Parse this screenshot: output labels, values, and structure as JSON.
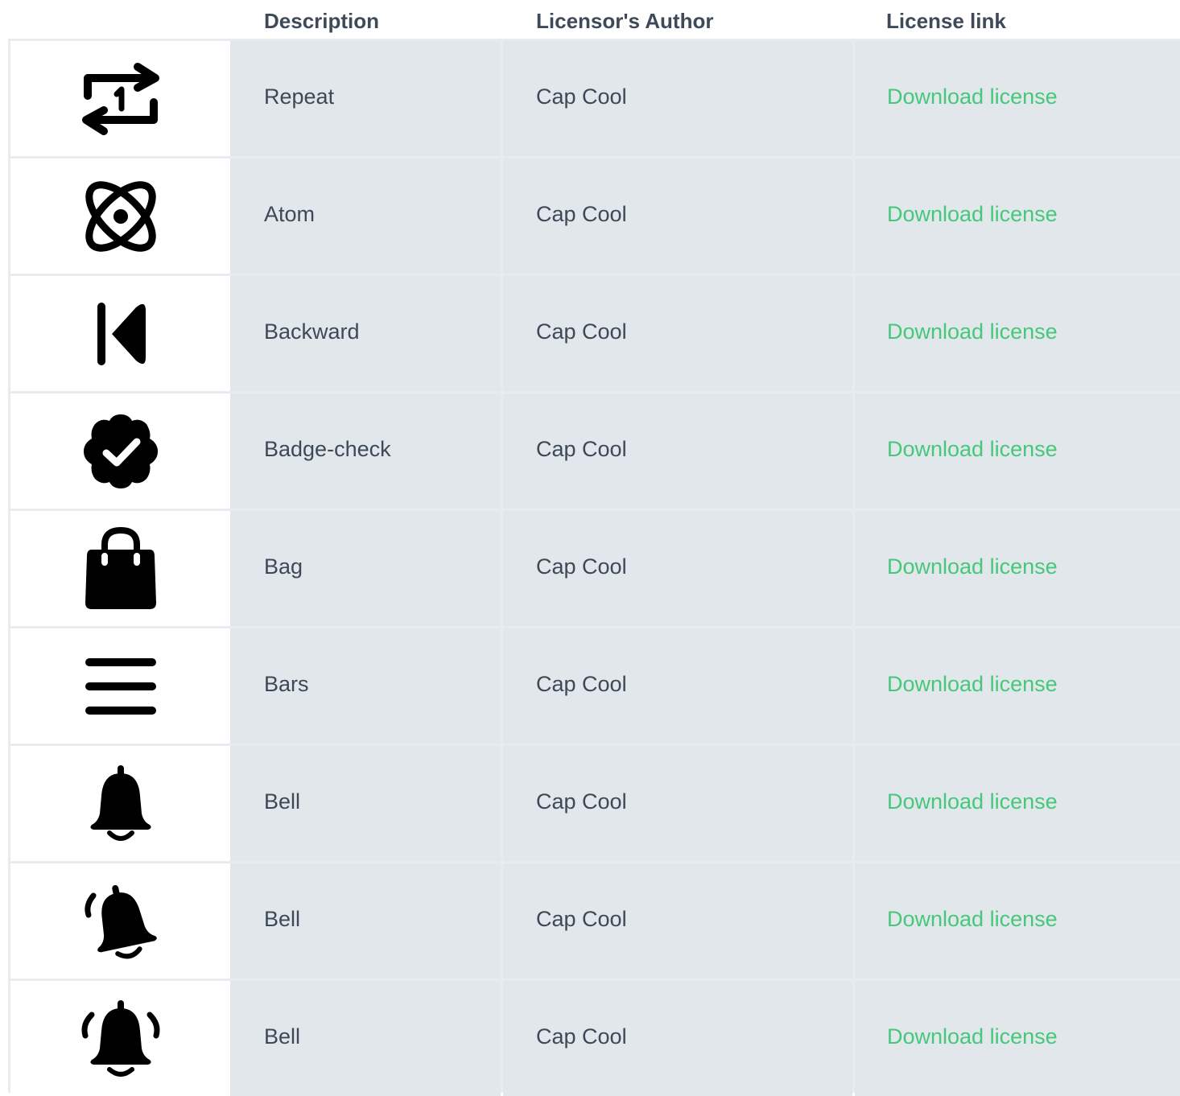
{
  "table": {
    "headers": {
      "icon": "",
      "description": "Description",
      "author": "Licensor's Author",
      "link": "License link"
    },
    "rows": [
      {
        "icon": "repeat-one-icon",
        "description": "Repeat",
        "author": "Cap Cool",
        "link": "Download license"
      },
      {
        "icon": "atom-icon",
        "description": "Atom",
        "author": "Cap Cool",
        "link": "Download license"
      },
      {
        "icon": "backward-icon",
        "description": "Backward",
        "author": "Cap Cool",
        "link": "Download license"
      },
      {
        "icon": "badge-check-icon",
        "description": "Badge-check",
        "author": "Cap Cool",
        "link": "Download license"
      },
      {
        "icon": "bag-icon",
        "description": "Bag",
        "author": "Cap Cool",
        "link": "Download license"
      },
      {
        "icon": "bars-icon",
        "description": "Bars",
        "author": "Cap Cool",
        "link": "Download license"
      },
      {
        "icon": "bell-icon",
        "description": "Bell",
        "author": "Cap Cool",
        "link": "Download license"
      },
      {
        "icon": "bell-ringing-icon",
        "description": "Bell",
        "author": "Cap Cool",
        "link": "Download license"
      },
      {
        "icon": "bell-ringing-both-icon",
        "description": "Bell",
        "author": "Cap Cool",
        "link": "Download license"
      }
    ]
  },
  "colors": {
    "link": "#46c87a",
    "text": "#3d4957",
    "cell_bg": "#e2e7ec",
    "icon_bg": "#ffffff"
  }
}
